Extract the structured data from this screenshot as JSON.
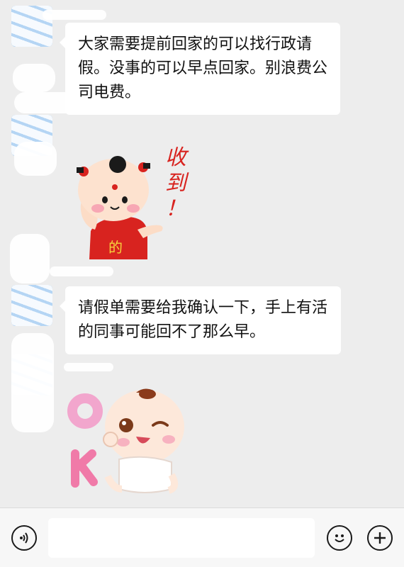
{
  "messages": [
    {
      "type": "text",
      "text": "大家需要提前回家的可以找行政请假。没事的可以早点回家。别浪费公司电费。"
    },
    {
      "type": "sticker",
      "sticker": "kid-with-shou-dao-sticker",
      "caption": "收到！"
    },
    {
      "type": "text",
      "text": "请假单需要给我确认一下，手上有活的同事可能回不了那么早。"
    },
    {
      "type": "sticker",
      "sticker": "baby-ok-sticker",
      "caption": "OK"
    }
  ],
  "input_bar": {
    "voice_icon": "voice-icon",
    "emoji_icon": "emoji-icon",
    "plus_icon": "plus-icon",
    "input_value": ""
  },
  "colors": {
    "background": "#ededed",
    "bubble": "#ffffff",
    "input_bar": "#f7f7f7"
  }
}
